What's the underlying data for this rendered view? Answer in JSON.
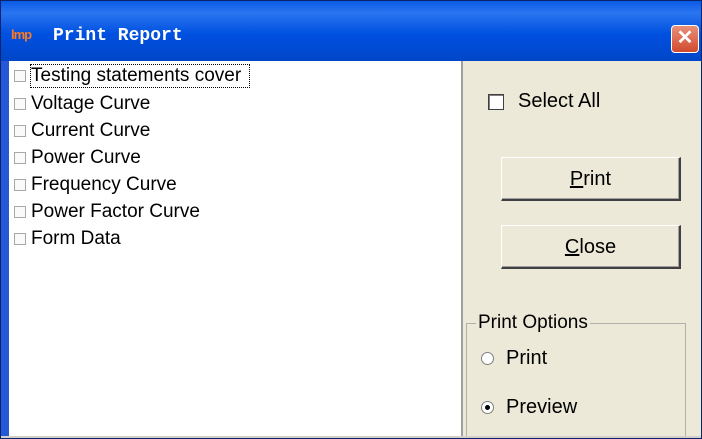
{
  "window": {
    "title": "Print Report",
    "app_icon_text": "lmp",
    "close_glyph": "✕"
  },
  "report_list": {
    "items": [
      {
        "label": "Testing statements cover",
        "checked": false,
        "focused": true
      },
      {
        "label": "Voltage Curve",
        "checked": false
      },
      {
        "label": "Current Curve",
        "checked": false
      },
      {
        "label": "Power Curve",
        "checked": false
      },
      {
        "label": "Frequency Curve",
        "checked": false
      },
      {
        "label": "Power Factor Curve",
        "checked": false
      },
      {
        "label": "Form Data",
        "checked": false
      }
    ]
  },
  "select_all": {
    "label": "Select All",
    "checked": false
  },
  "buttons": {
    "print": {
      "mnemonic": "P",
      "rest": "rint"
    },
    "close": {
      "mnemonic": "C",
      "rest": "lose"
    }
  },
  "print_options": {
    "legend": "Print Options",
    "options": [
      {
        "label": "Print",
        "selected": false
      },
      {
        "label": "Preview",
        "selected": true
      }
    ]
  },
  "colors": {
    "titlebar": "#0050e0",
    "panel": "#ece9d8",
    "close_button": "#d14a2c"
  }
}
